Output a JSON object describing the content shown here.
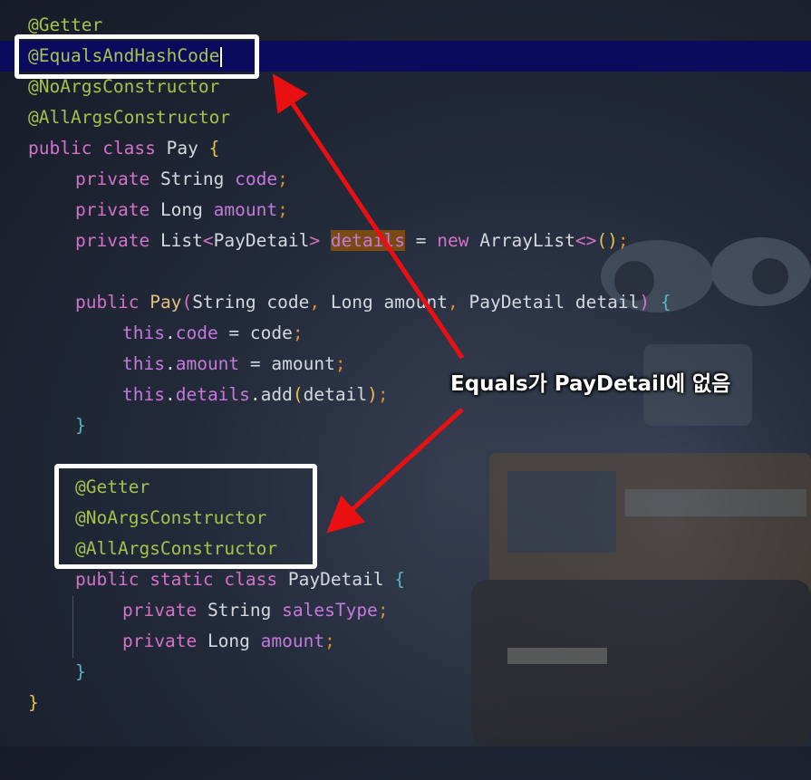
{
  "code": {
    "line1": {
      "annotation": "@Getter"
    },
    "line2": {
      "annotation": "@EqualsAndHashCode"
    },
    "line3": {
      "annotation": "@NoArgsConstructor"
    },
    "line4": {
      "annotation": "@AllArgsConstructor"
    },
    "line5": {
      "public": "public",
      "class": "class",
      "name": "Pay",
      "brace": "{"
    },
    "line6": {
      "private": "private",
      "type": "String",
      "field": "code",
      "semi": ";"
    },
    "line7": {
      "private": "private",
      "type": "Long",
      "field": "amount",
      "semi": ";"
    },
    "line8": {
      "private": "private",
      "type": "List",
      "lt": "<",
      "generic": "PayDetail",
      "gt": ">",
      "field": "details",
      "eq": " = ",
      "new": "new",
      "impl": "ArrayList",
      "diamond": "<>",
      "call": "()",
      "semi": ";"
    },
    "line10": {
      "public": "public",
      "ctor": "Pay",
      "open": "(",
      "p1": "String code",
      "comma1": ",",
      "p2": "Long amount",
      "comma2": ",",
      "p3": "PayDetail detail",
      "close": ")",
      "brace": "{"
    },
    "line11": {
      "this": "this",
      "dot": ".",
      "field": "code",
      "rest": " = code",
      "semi": ";"
    },
    "line12": {
      "this": "this",
      "dot": ".",
      "field": "amount",
      "rest": " = amount",
      "semi": ";"
    },
    "line13": {
      "this": "this",
      "dot": ".",
      "field": "details",
      "dot2": ".",
      "method": "add",
      "open": "(",
      "arg": "detail",
      "close": ")",
      "semi": ";"
    },
    "line14": {
      "brace": "}"
    },
    "line16": {
      "annotation": "@Getter"
    },
    "line17": {
      "annotation": "@NoArgsConstructor"
    },
    "line18": {
      "annotation": "@AllArgsConstructor"
    },
    "line19": {
      "public": "public",
      "static": "static",
      "class": "class",
      "name": "PayDetail",
      "brace": "{"
    },
    "line20": {
      "private": "private",
      "type": "String",
      "field": "salesType",
      "semi": ";"
    },
    "line21": {
      "private": "private",
      "type": "Long",
      "field": "amount",
      "semi": ";"
    },
    "line22": {
      "brace": "}"
    },
    "line23": {
      "brace": "}"
    }
  },
  "callout": {
    "text": "Equals가 PayDetail에 없음"
  },
  "colors": {
    "annotation": "#a7c24a",
    "keyword": "#d472c8",
    "field": "#c678dd",
    "current_line": "#0b0b5e",
    "arrow": "#e81010",
    "box": "#ffffff"
  }
}
